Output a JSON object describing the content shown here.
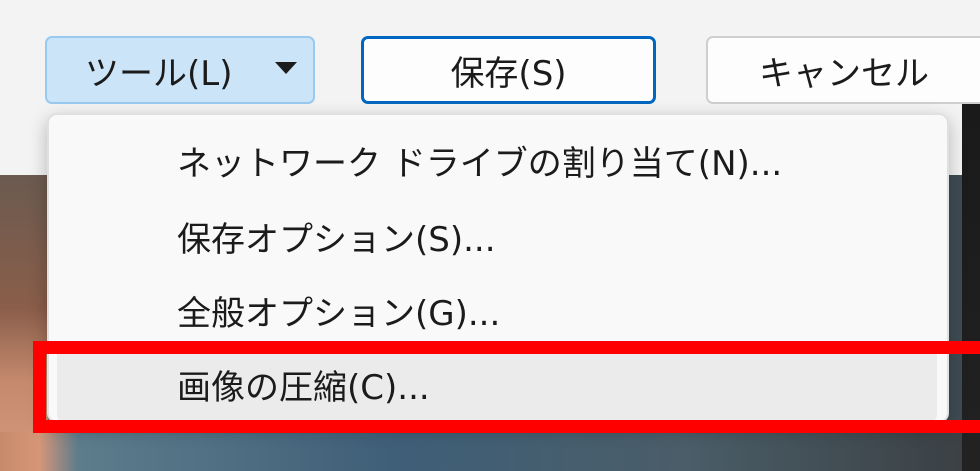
{
  "toolbar": {
    "tools_label": "ツール(L)",
    "save_label": "保存(S)",
    "cancel_label": "キャンセル"
  },
  "menu": {
    "items": [
      {
        "label": "ネットワーク ドライブの割り当て(N)..."
      },
      {
        "label": "保存オプション(S)..."
      },
      {
        "label": "全般オプション(G)..."
      },
      {
        "label": "画像の圧縮(C)...",
        "highlighted": true
      }
    ]
  },
  "colors": {
    "tools_button_bg": "#cce4f7",
    "save_button_border": "#0067c0",
    "highlight_box": "#ff0000"
  }
}
